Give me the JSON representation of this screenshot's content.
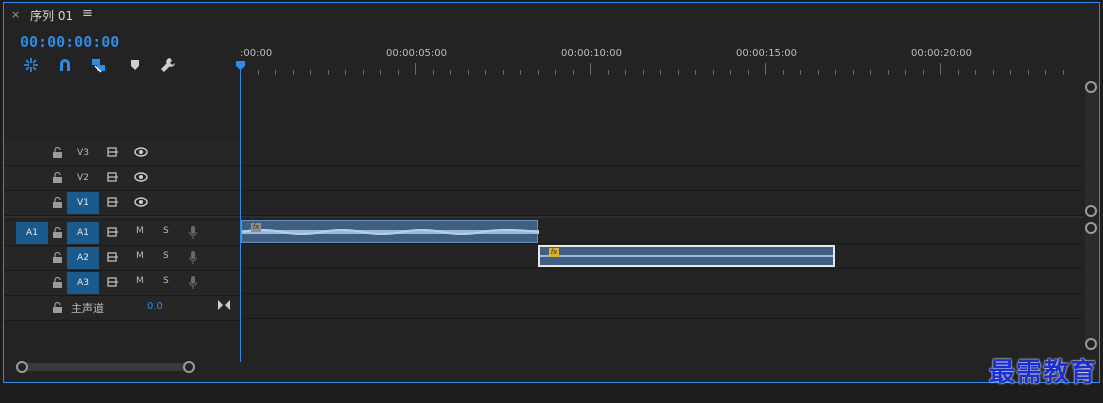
{
  "tab": {
    "close": "×",
    "title": "序列 01",
    "menu": "≡"
  },
  "timecode": "00:00:00:00",
  "ruler": {
    "labels": [
      ":00:00",
      "00:00:05:00",
      "00:00:10:00",
      "00:00:15:00",
      "00:00:20:00"
    ]
  },
  "tracks": {
    "video": [
      {
        "label": "V3",
        "active": false
      },
      {
        "label": "V2",
        "active": false
      },
      {
        "label": "V1",
        "active": true
      }
    ],
    "audio": [
      {
        "label": "A1",
        "active": true,
        "source": "A1",
        "m": "M",
        "s": "S"
      },
      {
        "label": "A2",
        "active": true,
        "m": "M",
        "s": "S"
      },
      {
        "label": "A3",
        "active": true,
        "m": "M",
        "s": "S"
      }
    ],
    "master": {
      "label": "主声道",
      "value": "0.0"
    }
  },
  "watermark": "最需教育",
  "colors": {
    "accent": "#2d8ceb",
    "track_active": "#1b5a8c",
    "clip": "#3f5f83"
  }
}
